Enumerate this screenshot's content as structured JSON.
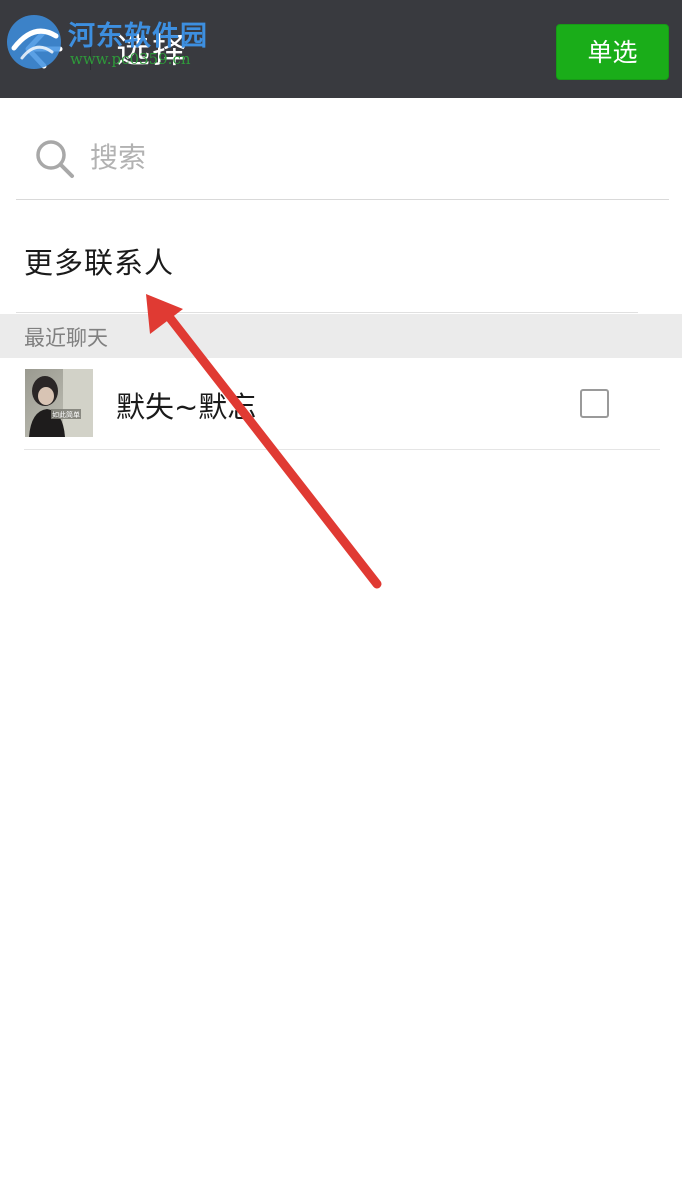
{
  "header": {
    "title": "选择",
    "single_select_label": "单选",
    "back_icon": "back-arrow-icon",
    "background_color": "#393a3f",
    "accent_color": "#1aad19"
  },
  "watermark": {
    "site_name": "河东软件园",
    "url": "www.pc0359.cn"
  },
  "search": {
    "placeholder": "搜索",
    "value": "",
    "icon": "search-icon"
  },
  "more_contacts": {
    "label": "更多联系人"
  },
  "recent_chats": {
    "header": "最近聊天",
    "items": [
      {
        "name": "默失~默忘",
        "avatar_caption": "如此简单",
        "checked": false
      }
    ]
  },
  "annotation": {
    "type": "arrow",
    "color": "#e03a33"
  }
}
